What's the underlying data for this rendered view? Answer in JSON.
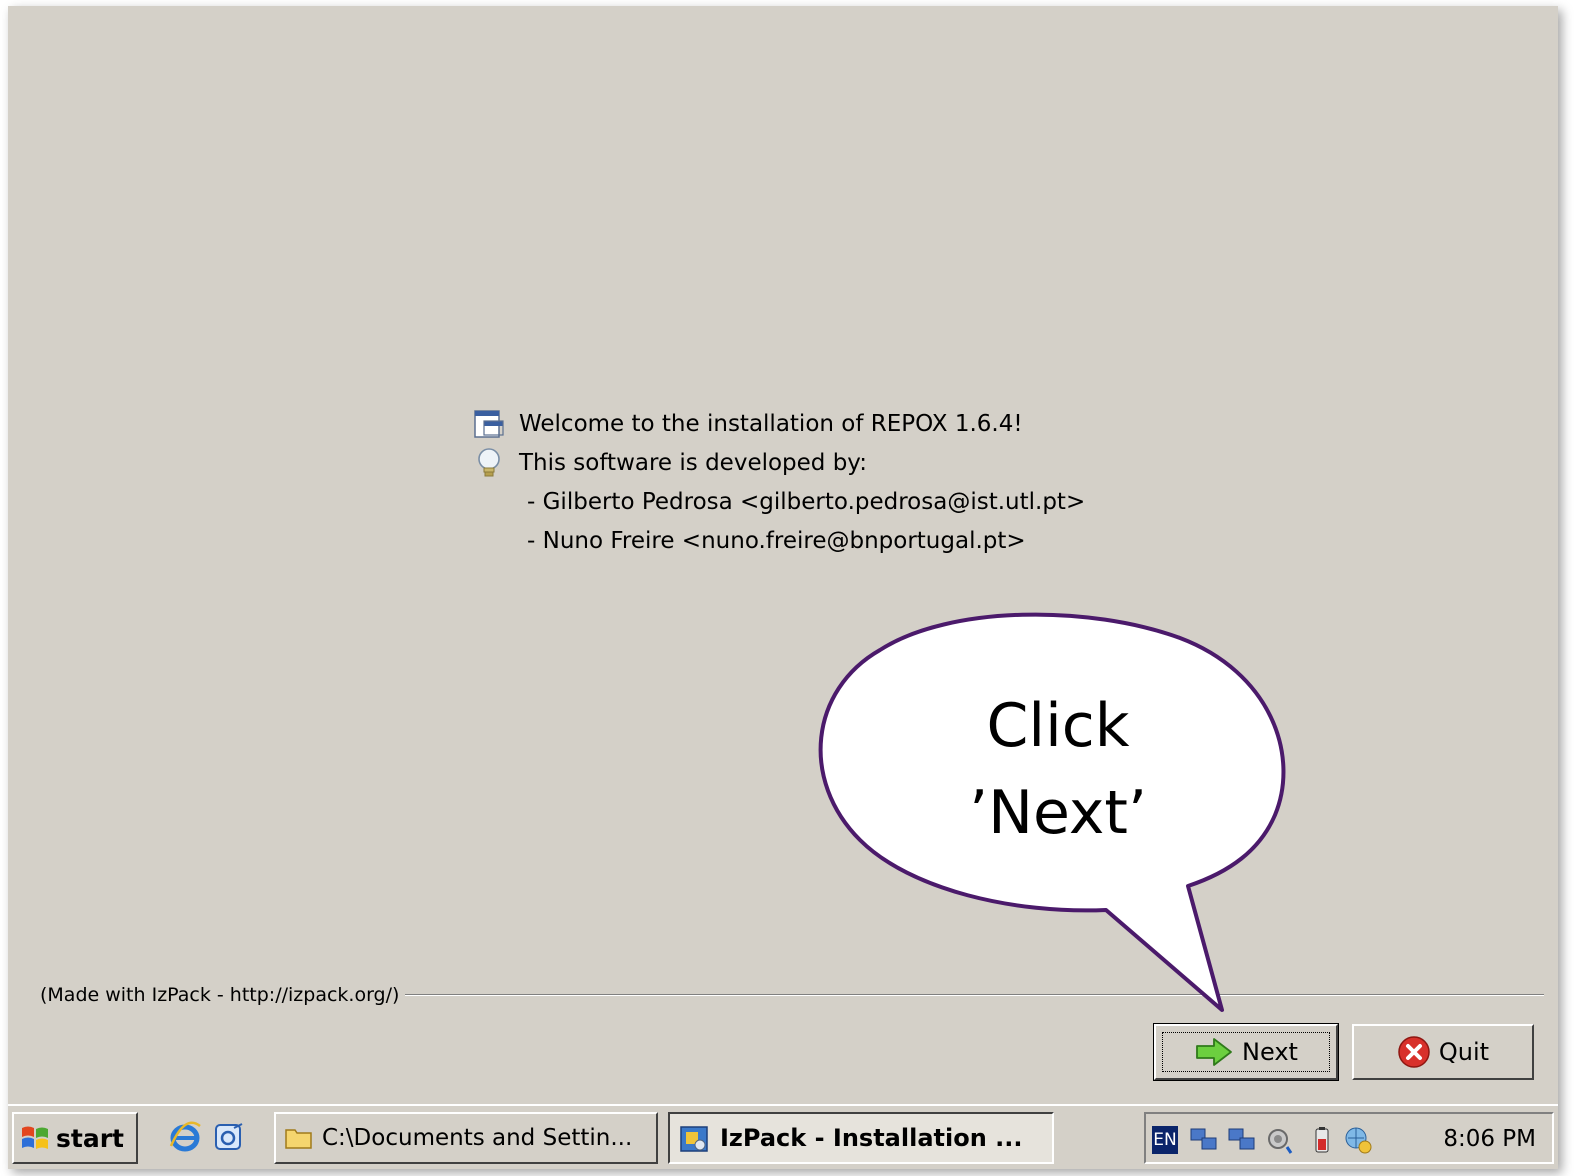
{
  "installer": {
    "welcome_text": "Welcome to the installation of REPOX 1.6.4!",
    "developed_by": "This software is developed by:",
    "developers": [
      "- Gilberto Pedrosa <gilberto.pedrosa@ist.utl.pt>",
      "- Nuno Freire <nuno.freire@bnportugal.pt>"
    ],
    "credit": "(Made with IzPack - http://izpack.org/)",
    "next_label": "Next",
    "quit_label": "Quit"
  },
  "callout": {
    "line1": "Click",
    "line2": "’Next’",
    "border_color": "#4b1a6b"
  },
  "taskbar": {
    "start_label": "start",
    "tasks": [
      {
        "label": "C:\\Documents and Settin...",
        "active": false
      },
      {
        "label": "IzPack - Installation ...",
        "active": true
      }
    ],
    "lang": "EN",
    "clock": "8:06 PM"
  },
  "icons": {
    "welcome": "window-icon",
    "info": "lightbulb-icon",
    "next": "green-arrow-icon",
    "quit": "red-x-icon"
  }
}
